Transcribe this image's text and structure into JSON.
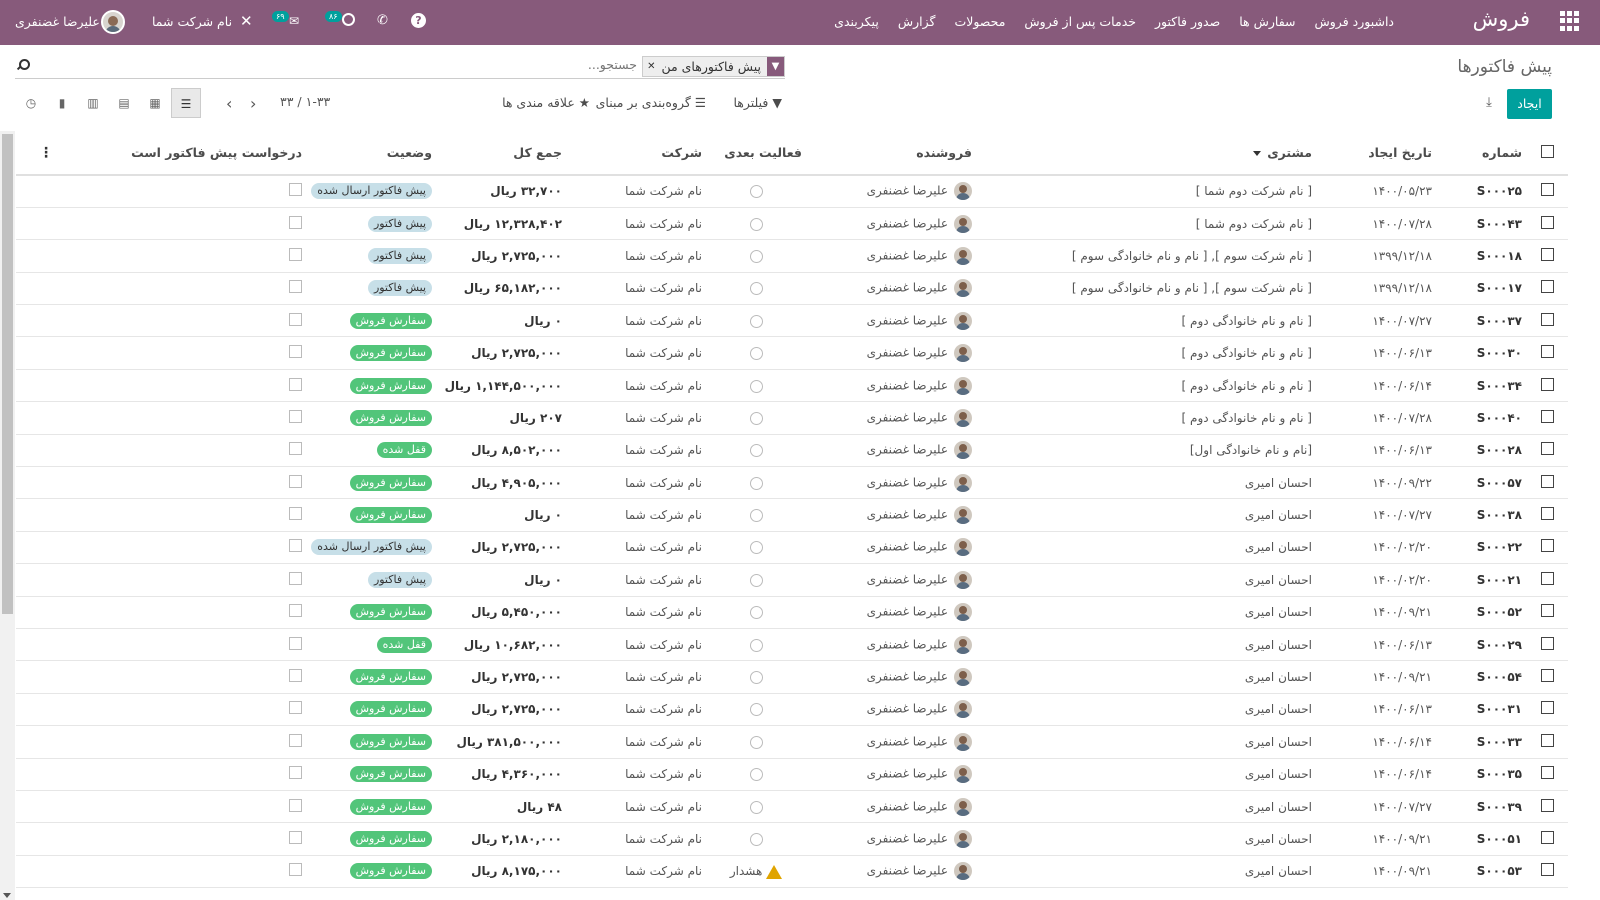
{
  "navbar": {
    "brand": "فروش",
    "menu": [
      "داشبورد فروش",
      "سفارش ها",
      "صدور فاکتور",
      "خدمات پس از فروش",
      "محصولات",
      "گزارش",
      "پیکربندی"
    ],
    "user_name": "علیرضا غضنفری",
    "company_name": "نام شرکت شما",
    "chat_badge": "۶۹",
    "activity_badge": "۸۶",
    "debug_glyph": "✕",
    "phone_glyph": "✆",
    "help_glyph": "?",
    "chat_glyph": "✉"
  },
  "control_panel": {
    "breadcrumb": "پیش فاکتورها",
    "facet_value": "پیش فاکتورهای من",
    "facet_icon": "▼",
    "facet_remove": "✕",
    "search_placeholder": "جستجو...",
    "create_label": "ایجاد",
    "download_glyph": "⤓",
    "filters_label": "▼ فیلترها",
    "groupby_label": "☰ گروه‌بندی بر مبنای",
    "favorites_label": "★ علاقه مندی ها",
    "pager": "۱-۳۳ / ۳۳",
    "pager_prev": "‹",
    "pager_next": "›",
    "views": [
      "☰",
      "▦",
      "▤",
      "▥",
      "▮",
      "◷"
    ]
  },
  "table": {
    "headers": {
      "number": "شماره",
      "date": "تاریخ ایجاد",
      "customer": "مشتری",
      "salesperson": "فروشنده",
      "activity": "فعالیت بعدی",
      "company": "شرکت",
      "total": "جمع کل",
      "status": "وضعیت",
      "quote_request": "درخواست پیش فاکتور است",
      "options_glyph": "⋮"
    },
    "rows": [
      {
        "number": "S۰۰۰۲۵",
        "date": "۱۴۰۰/۰۵/۲۳",
        "customer": "[ نام شرکت دوم شما ]",
        "salesperson": "علیرضا غضنفری",
        "activity": "",
        "company": "نام شرکت شما",
        "total": "۳۲,۷۰۰ ریال",
        "status": "پیش فاکتور ارسال شده",
        "status_kind": "sent"
      },
      {
        "number": "S۰۰۰۴۳",
        "date": "۱۴۰۰/۰۷/۲۸",
        "customer": "[ نام شرکت دوم شما ]",
        "salesperson": "علیرضا غضنفری",
        "activity": "",
        "company": "نام شرکت شما",
        "total": "۱۲,۳۲۸,۴۰۲ ریال",
        "status": "پیش فاکتور",
        "status_kind": "draft"
      },
      {
        "number": "S۰۰۰۱۸",
        "date": "۱۳۹۹/۱۲/۱۸",
        "customer": "[ نام شرکت سوم ], [ نام و نام خانوادگی سوم ]",
        "salesperson": "علیرضا غضنفری",
        "activity": "",
        "company": "نام شرکت شما",
        "total": "۲,۷۲۵,۰۰۰ ریال",
        "status": "پیش فاکتور",
        "status_kind": "draft"
      },
      {
        "number": "S۰۰۰۱۷",
        "date": "۱۳۹۹/۱۲/۱۸",
        "customer": "[ نام شرکت سوم ], [ نام و نام خانوادگی سوم ]",
        "salesperson": "علیرضا غضنفری",
        "activity": "",
        "company": "نام شرکت شما",
        "total": "۶۵,۱۸۲,۰۰۰ ریال",
        "status": "پیش فاکتور",
        "status_kind": "draft"
      },
      {
        "number": "S۰۰۰۳۷",
        "date": "۱۴۰۰/۰۷/۲۷",
        "customer": "[ نام و نام خانوادگی دوم ]",
        "salesperson": "علیرضا غضنفری",
        "activity": "",
        "company": "نام شرکت شما",
        "total": "۰ ریال",
        "status": "سفارش فروش",
        "status_kind": "sale"
      },
      {
        "number": "S۰۰۰۳۰",
        "date": "۱۴۰۰/۰۶/۱۳",
        "customer": "[ نام و نام خانوادگی دوم ]",
        "salesperson": "علیرضا غضنفری",
        "activity": "",
        "company": "نام شرکت شما",
        "total": "۲,۷۲۵,۰۰۰ ریال",
        "status": "سفارش فروش",
        "status_kind": "sale"
      },
      {
        "number": "S۰۰۰۳۴",
        "date": "۱۴۰۰/۰۶/۱۴",
        "customer": "[ نام و نام خانوادگی دوم ]",
        "salesperson": "علیرضا غضنفری",
        "activity": "",
        "company": "نام شرکت شما",
        "total": "۱,۱۴۴,۵۰۰,۰۰۰ ریال",
        "status": "سفارش فروش",
        "status_kind": "sale"
      },
      {
        "number": "S۰۰۰۴۰",
        "date": "۱۴۰۰/۰۷/۲۸",
        "customer": "[ نام و نام خانوادگی دوم ]",
        "salesperson": "علیرضا غضنفری",
        "activity": "",
        "company": "نام شرکت شما",
        "total": "۲۰۷ ریال",
        "status": "سفارش فروش",
        "status_kind": "sale"
      },
      {
        "number": "S۰۰۰۲۸",
        "date": "۱۴۰۰/۰۶/۱۳",
        "customer": "[نام و نام خانوادگی اول]",
        "salesperson": "علیرضا غضنفری",
        "activity": "",
        "company": "نام شرکت شما",
        "total": "۸,۵۰۲,۰۰۰ ریال",
        "status": "قفل شده",
        "status_kind": "done"
      },
      {
        "number": "S۰۰۰۵۷",
        "date": "۱۴۰۰/۰۹/۲۲",
        "customer": "احسان امیری",
        "salesperson": "علیرضا غضنفری",
        "activity": "",
        "company": "نام شرکت شما",
        "total": "۴,۹۰۵,۰۰۰ ریال",
        "status": "سفارش فروش",
        "status_kind": "sale"
      },
      {
        "number": "S۰۰۰۳۸",
        "date": "۱۴۰۰/۰۷/۲۷",
        "customer": "احسان امیری",
        "salesperson": "علیرضا غضنفری",
        "activity": "",
        "company": "نام شرکت شما",
        "total": "۰ ریال",
        "status": "سفارش فروش",
        "status_kind": "sale"
      },
      {
        "number": "S۰۰۰۲۲",
        "date": "۱۴۰۰/۰۲/۲۰",
        "customer": "احسان امیری",
        "salesperson": "علیرضا غضنفری",
        "activity": "",
        "company": "نام شرکت شما",
        "total": "۲,۷۲۵,۰۰۰ ریال",
        "status": "پیش فاکتور ارسال شده",
        "status_kind": "sent"
      },
      {
        "number": "S۰۰۰۲۱",
        "date": "۱۴۰۰/۰۲/۲۰",
        "customer": "احسان امیری",
        "salesperson": "علیرضا غضنفری",
        "activity": "",
        "company": "نام شرکت شما",
        "total": "۰ ریال",
        "status": "پیش فاکتور",
        "status_kind": "draft"
      },
      {
        "number": "S۰۰۰۵۲",
        "date": "۱۴۰۰/۰۹/۲۱",
        "customer": "احسان امیری",
        "salesperson": "علیرضا غضنفری",
        "activity": "",
        "company": "نام شرکت شما",
        "total": "۵,۴۵۰,۰۰۰ ریال",
        "status": "سفارش فروش",
        "status_kind": "sale"
      },
      {
        "number": "S۰۰۰۲۹",
        "date": "۱۴۰۰/۰۶/۱۳",
        "customer": "احسان امیری",
        "salesperson": "علیرضا غضنفری",
        "activity": "",
        "company": "نام شرکت شما",
        "total": "۱۰,۶۸۲,۰۰۰ ریال",
        "status": "قفل شده",
        "status_kind": "done"
      },
      {
        "number": "S۰۰۰۵۴",
        "date": "۱۴۰۰/۰۹/۲۱",
        "customer": "احسان امیری",
        "salesperson": "علیرضا غضنفری",
        "activity": "",
        "company": "نام شرکت شما",
        "total": "۲,۷۲۵,۰۰۰ ریال",
        "status": "سفارش فروش",
        "status_kind": "sale"
      },
      {
        "number": "S۰۰۰۳۱",
        "date": "۱۴۰۰/۰۶/۱۳",
        "customer": "احسان امیری",
        "salesperson": "علیرضا غضنفری",
        "activity": "",
        "company": "نام شرکت شما",
        "total": "۲,۷۲۵,۰۰۰ ریال",
        "status": "سفارش فروش",
        "status_kind": "sale"
      },
      {
        "number": "S۰۰۰۳۳",
        "date": "۱۴۰۰/۰۶/۱۴",
        "customer": "احسان امیری",
        "salesperson": "علیرضا غضنفری",
        "activity": "",
        "company": "نام شرکت شما",
        "total": "۳۸۱,۵۰۰,۰۰۰ ریال",
        "status": "سفارش فروش",
        "status_kind": "sale"
      },
      {
        "number": "S۰۰۰۳۵",
        "date": "۱۴۰۰/۰۶/۱۴",
        "customer": "احسان امیری",
        "salesperson": "علیرضا غضنفری",
        "activity": "",
        "company": "نام شرکت شما",
        "total": "۴,۳۶۰,۰۰۰ ریال",
        "status": "سفارش فروش",
        "status_kind": "sale"
      },
      {
        "number": "S۰۰۰۳۹",
        "date": "۱۴۰۰/۰۷/۲۷",
        "customer": "احسان امیری",
        "salesperson": "علیرضا غضنفری",
        "activity": "",
        "company": "نام شرکت شما",
        "total": "۴۸ ریال",
        "status": "سفارش فروش",
        "status_kind": "sale"
      },
      {
        "number": "S۰۰۰۵۱",
        "date": "۱۴۰۰/۰۹/۲۱",
        "customer": "احسان امیری",
        "salesperson": "علیرضا غضنفری",
        "activity": "",
        "company": "نام شرکت شما",
        "total": "۲,۱۸۰,۰۰۰ ریال",
        "status": "سفارش فروش",
        "status_kind": "sale"
      },
      {
        "number": "S۰۰۰۵۳",
        "date": "۱۴۰۰/۰۹/۲۱",
        "customer": "احسان امیری",
        "salesperson": "علیرضا غضنفری",
        "activity": "هشدار",
        "company": "نام شرکت شما",
        "total": "۸,۱۷۵,۰۰۰ ریال",
        "status": "سفارش فروش",
        "status_kind": "sale"
      }
    ]
  },
  "colors": {
    "navbar": "#875a7b",
    "primary_button": "#00a09d",
    "status_sale": "#52c57a",
    "status_draft": "#c7dfe8",
    "warning": "#e0a400"
  }
}
